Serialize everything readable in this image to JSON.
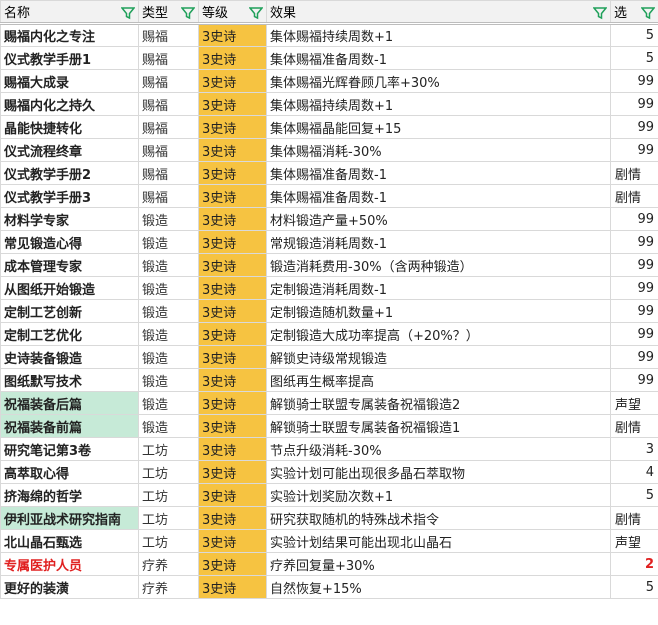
{
  "header": {
    "name": "名称",
    "type": "类型",
    "grade": "等级",
    "effect": "效果",
    "select": "选"
  },
  "rows": [
    {
      "name": "赐福内化之专注",
      "type": "赐福",
      "grade": "3史诗",
      "effect": "集体赐福持续周数+1",
      "select": "5"
    },
    {
      "name": "仪式教学手册1",
      "type": "赐福",
      "grade": "3史诗",
      "effect": "集体赐福准备周数-1",
      "select": "5"
    },
    {
      "name": "赐福大成录",
      "type": "赐福",
      "grade": "3史诗",
      "effect": "集体赐福光辉眷顾几率+30%",
      "select": "99"
    },
    {
      "name": "赐福内化之持久",
      "type": "赐福",
      "grade": "3史诗",
      "effect": "集体赐福持续周数+1",
      "select": "99"
    },
    {
      "name": "晶能快捷转化",
      "type": "赐福",
      "grade": "3史诗",
      "effect": "集体赐福晶能回复+15",
      "select": "99"
    },
    {
      "name": "仪式流程终章",
      "type": "赐福",
      "grade": "3史诗",
      "effect": "集体赐福消耗-30%",
      "select": "99"
    },
    {
      "name": "仪式教学手册2",
      "type": "赐福",
      "grade": "3史诗",
      "effect": "集体赐福准备周数-1",
      "select": "剧情"
    },
    {
      "name": "仪式教学手册3",
      "type": "赐福",
      "grade": "3史诗",
      "effect": "集体赐福准备周数-1",
      "select": "剧情"
    },
    {
      "name": "材料学专家",
      "type": "锻造",
      "grade": "3史诗",
      "effect": "材料锻造产量+50%",
      "select": "99"
    },
    {
      "name": "常见锻造心得",
      "type": "锻造",
      "grade": "3史诗",
      "effect": "常规锻造消耗周数-1",
      "select": "99"
    },
    {
      "name": "成本管理专家",
      "type": "锻造",
      "grade": "3史诗",
      "effect": "锻造消耗费用-30%（含两种锻造）",
      "select": "99"
    },
    {
      "name": "从图纸开始锻造",
      "type": "锻造",
      "grade": "3史诗",
      "effect": "定制锻造消耗周数-1",
      "select": "99"
    },
    {
      "name": "定制工艺创新",
      "type": "锻造",
      "grade": "3史诗",
      "effect": "定制锻造随机数量+1",
      "select": "99"
    },
    {
      "name": "定制工艺优化",
      "type": "锻造",
      "grade": "3史诗",
      "effect": "定制锻造大成功率提高（+20%？）",
      "select": "99"
    },
    {
      "name": "史诗装备锻造",
      "type": "锻造",
      "grade": "3史诗",
      "effect": "解锁史诗级常规锻造",
      "select": "99"
    },
    {
      "name": "图纸默写技术",
      "type": "锻造",
      "grade": "3史诗",
      "effect": "图纸再生概率提高",
      "select": "99"
    },
    {
      "name": "祝福装备后篇",
      "type": "锻造",
      "grade": "3史诗",
      "effect": "解锁骑士联盟专属装备祝福锻造2",
      "select": "声望",
      "highlight": "green"
    },
    {
      "name": "祝福装备前篇",
      "type": "锻造",
      "grade": "3史诗",
      "effect": "解锁骑士联盟专属装备祝福锻造1",
      "select": "剧情",
      "highlight": "green"
    },
    {
      "name": "研究笔记第3卷",
      "type": "工坊",
      "grade": "3史诗",
      "effect": "节点升级消耗-30%",
      "select": "3"
    },
    {
      "name": "高萃取心得",
      "type": "工坊",
      "grade": "3史诗",
      "effect": "实验计划可能出现很多晶石萃取物",
      "select": "4"
    },
    {
      "name": "挤海绵的哲学",
      "type": "工坊",
      "grade": "3史诗",
      "effect": "实验计划奖励次数+1",
      "select": "5"
    },
    {
      "name": "伊利亚战术研究指南",
      "type": "工坊",
      "grade": "3史诗",
      "effect": "研究获取随机的特殊战术指令",
      "select": "剧情",
      "highlight": "green"
    },
    {
      "name": "北山晶石甄选",
      "type": "工坊",
      "grade": "3史诗",
      "effect": "实验计划结果可能出现北山晶石",
      "select": "声望"
    },
    {
      "name": "专属医护人员",
      "type": "疗养",
      "grade": "3史诗",
      "effect": "疗养回复量+30%",
      "select": "2",
      "highlight": "red"
    },
    {
      "name": "更好的装潢",
      "type": "疗养",
      "grade": "3史诗",
      "effect": "自然恢复+15%",
      "select": "5"
    }
  ],
  "colors": {
    "grade_bg": "#f6c341",
    "green_highlight": "#c6ead7",
    "red_text": "#e02020",
    "filter_icon": "#1fa05a"
  },
  "icons": {
    "filter": "filter-icon"
  }
}
